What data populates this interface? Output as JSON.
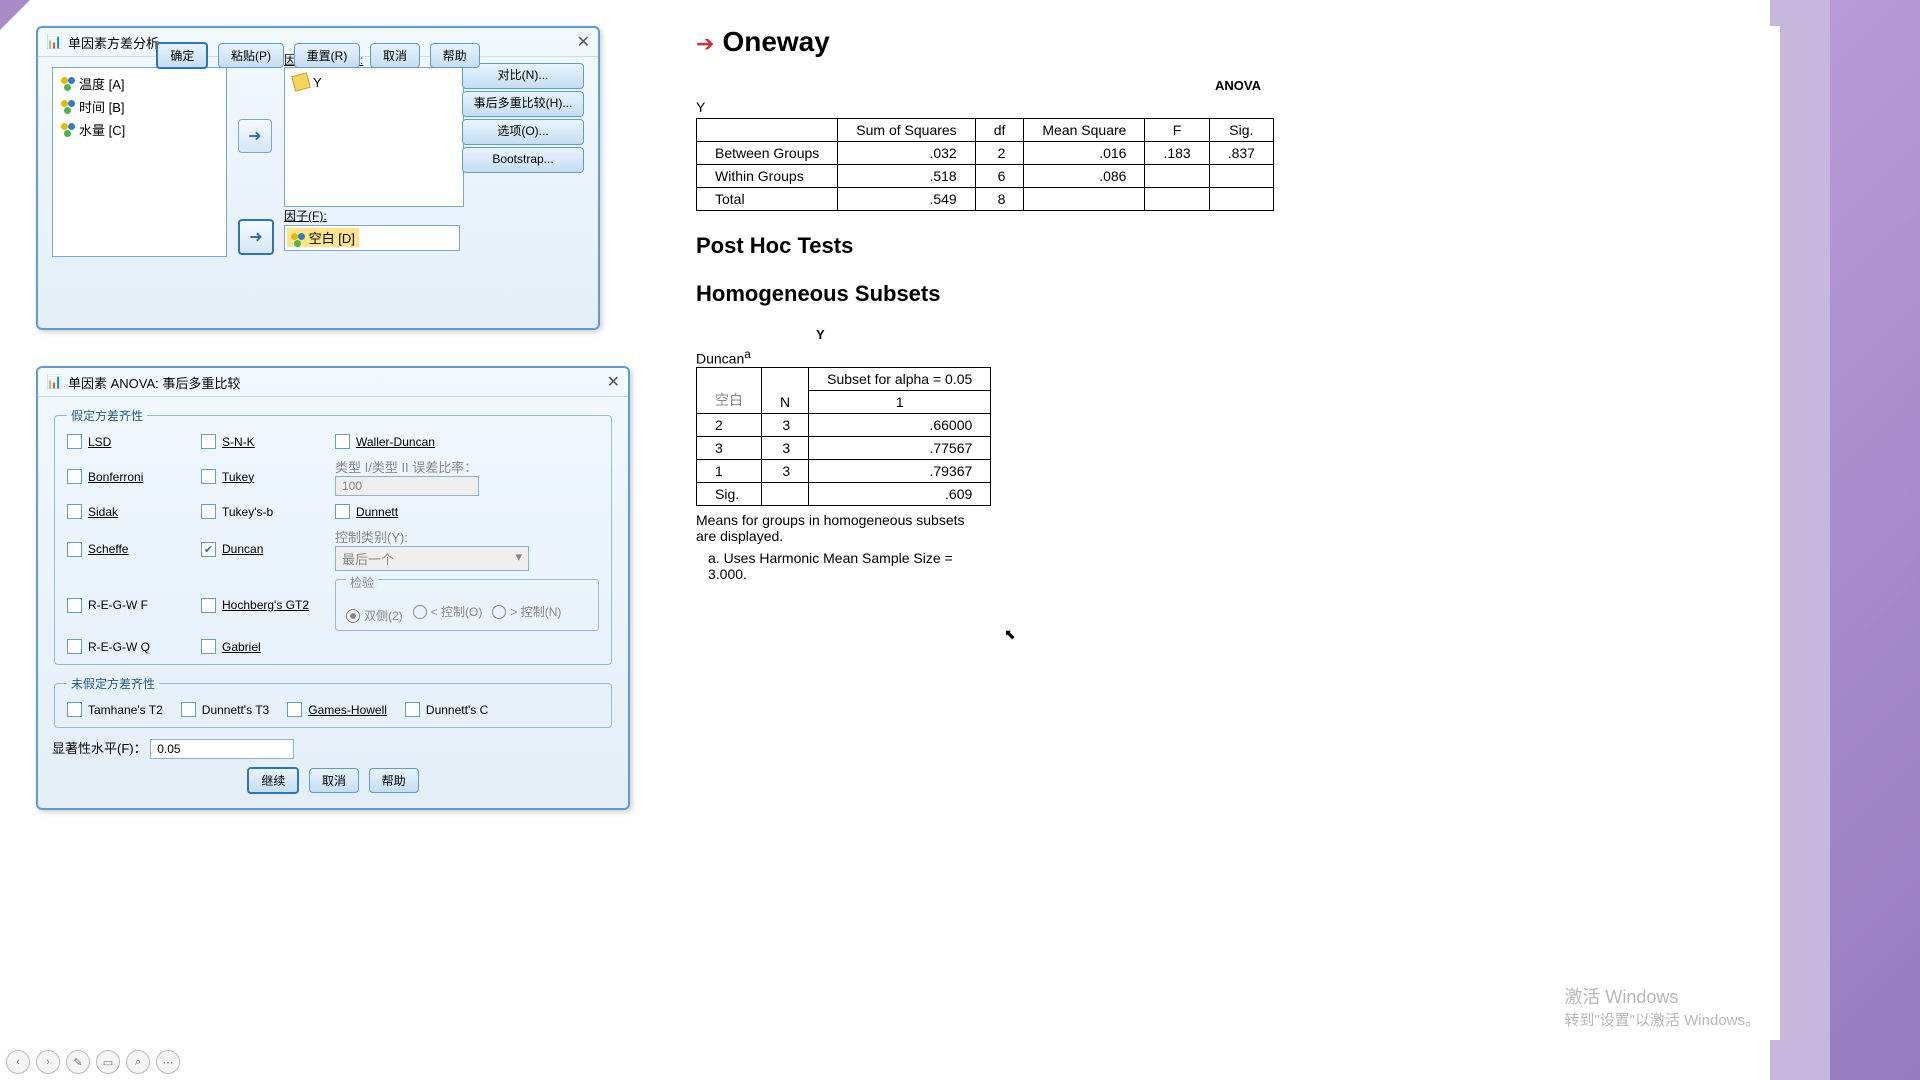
{
  "dialog1": {
    "title": "单因素方差分析",
    "dep_label": "因变量列表(E):",
    "factor_label": "因子(F):",
    "vars": [
      "温度 [A]",
      "时间 [B]",
      "水量 [C]"
    ],
    "depvar": "Y",
    "factor": "空白 [D]",
    "contrast": "对比(N)...",
    "posthoc": "事后多重比较(H)...",
    "options": "选项(O)...",
    "bootstrap": "Bootstrap...",
    "ok": "确定",
    "paste": "粘贴(P)",
    "reset": "重置(R)",
    "cancel": "取消",
    "help": "帮助"
  },
  "dialog2": {
    "title": "单因素 ANOVA: 事后多重比较",
    "fs1": "假定方差齐性",
    "fs2": "未假定方差齐性",
    "checks": {
      "lsd": "LSD",
      "bon": "Bonferroni",
      "sidak": "Sidak",
      "scheffe": "Scheffe",
      "regwf": "R-E-G-W F",
      "regwq": "R-E-G-W Q",
      "snk": "S-N-K",
      "tukey": "Tukey",
      "tukeysb": "Tukey's-b",
      "duncan": "Duncan",
      "hoch": "Hochberg's GT2",
      "gabriel": "Gabriel",
      "waller": "Waller-Duncan",
      "dunnett": "Dunnett",
      "tamhane": "Tamhane's T2",
      "dunnt3": "Dunnett's T3",
      "games": "Games-Howell",
      "dunnc": "Dunnett's C"
    },
    "errratio_lbl": "类型 I/类型 II 误差比率：",
    "errratio": "100",
    "ctrlcat": "控制类别(Y):",
    "ctrlcat_val": "最后一个",
    "testlbl": "检验",
    "r1": "双侧(2)",
    "r2": "< 控制(O)",
    "r3": "> 控制(N)",
    "sig_lbl": "显著性水平(F)：",
    "sig": "0.05",
    "cont": "继续",
    "cancel": "取消",
    "help": "帮助"
  },
  "output": {
    "oneway": "Oneway",
    "anova": "ANOVA",
    "y": "Y",
    "th": {
      "ss": "Sum of Squares",
      "df": "df",
      "ms": "Mean Square",
      "f": "F",
      "sig": "Sig."
    },
    "rows": [
      {
        "n": "Between Groups",
        "ss": ".032",
        "df": "2",
        "ms": ".016",
        "f": ".183",
        "sig": ".837"
      },
      {
        "n": "Within Groups",
        "ss": ".518",
        "df": "6",
        "ms": ".086",
        "f": "",
        "sig": ""
      },
      {
        "n": "Total",
        "ss": ".549",
        "df": "8",
        "ms": "",
        "f": "",
        "sig": ""
      }
    ],
    "posthoc": "Post Hoc Tests",
    "homsub": "Homogeneous Subsets",
    "duncan": "Duncan",
    "th2": {
      "blank": "空白",
      "n": "N",
      "subset": "Subset for alpha = 0.05",
      "one": "1"
    },
    "drows": [
      {
        "g": "2",
        "n": "3",
        "v": ".66000"
      },
      {
        "g": "3",
        "n": "3",
        "v": ".77567"
      },
      {
        "g": "1",
        "n": "3",
        "v": ".79367"
      }
    ],
    "sigrow": {
      "g": "Sig.",
      "v": ".609"
    },
    "note1": "Means for groups in homogeneous subsets are displayed.",
    "note2": "a. Uses Harmonic Mean Sample Size = 3.000."
  },
  "watermark": {
    "l1": "激活 Windows",
    "l2": "转到\"设置\"以激活 Windows。"
  }
}
